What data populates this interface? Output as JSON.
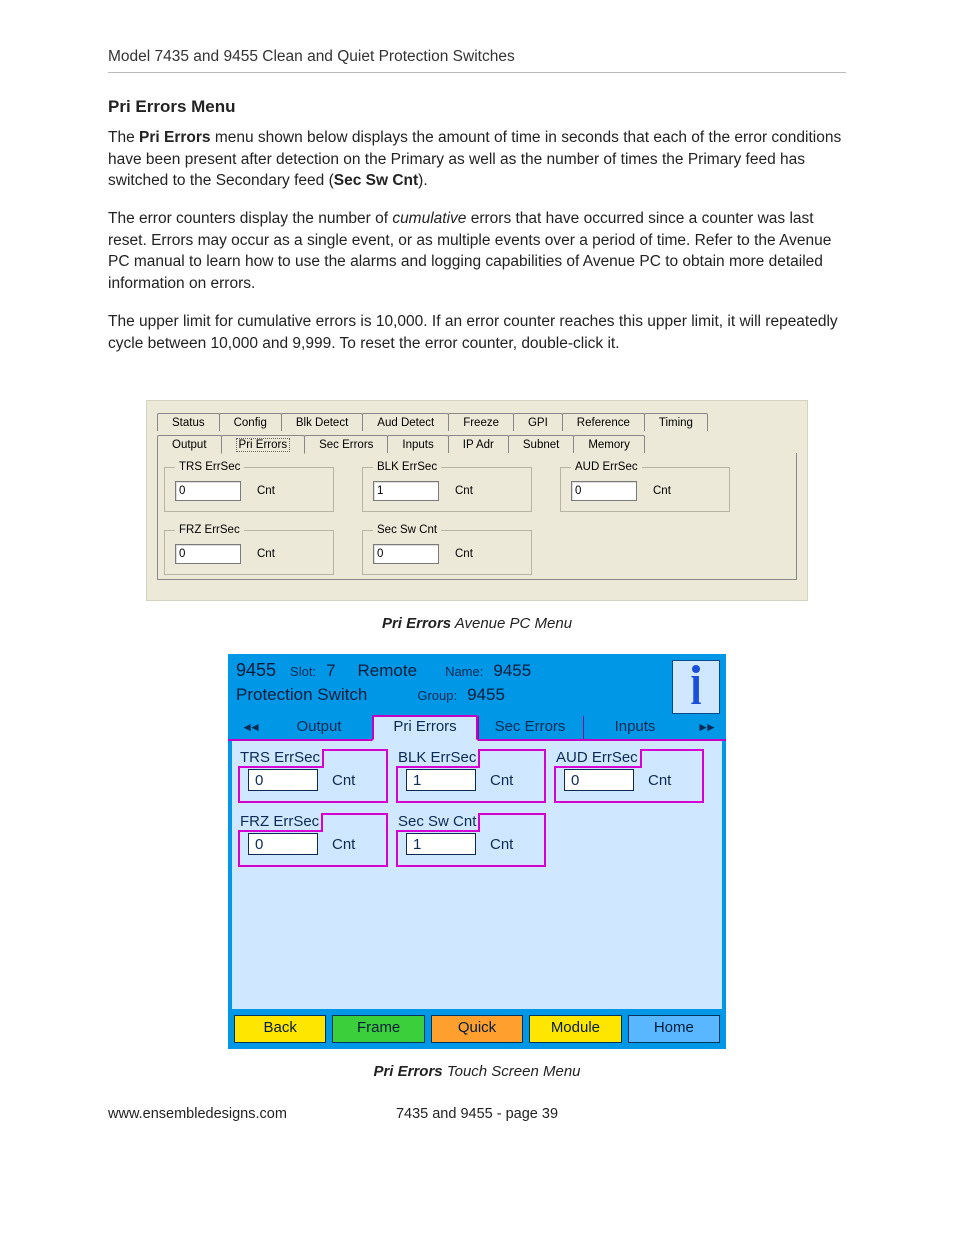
{
  "header": {
    "title": "Model 7435 and 9455 Clean and Quiet Protection Switches"
  },
  "section": {
    "heading": "Pri Errors Menu"
  },
  "paragraphs": {
    "p1_a": "The ",
    "p1_b": "Pri Errors",
    "p1_c": " menu shown below displays the amount of time in seconds that each of the error conditions have been present after detection on the Primary as well as the number of times the Primary feed has switched to the Secondary feed (",
    "p1_d": "Sec Sw Cnt",
    "p1_e": ").",
    "p2_a": "The error counters display the number of ",
    "p2_b": "cumulative",
    "p2_c": " errors that have occurred since a counter was last reset. Errors may occur as a single event, or as multiple events over a period of time. Refer to the Avenue PC manual to learn how to use the alarms and logging capabilities of Avenue PC to obtain more detailed information on errors.",
    "p3": "The upper limit for cumulative errors is 10,000. If an error counter reaches this upper limit, it will repeatedly cycle between 10,000 and 9,999. To reset the error counter, double-click it."
  },
  "pcmenu": {
    "tabs_row1": [
      "Status",
      "Config",
      "Blk Detect",
      "Aud Detect",
      "Freeze",
      "GPI",
      "Reference",
      "Timing"
    ],
    "tabs_row2": [
      "Output",
      "Pri Errors",
      "Sec Errors",
      "Inputs",
      "IP Adr",
      "Subnet",
      "Memory"
    ],
    "selected_tab": "Pri Errors",
    "groups": [
      {
        "legend": "TRS ErrSec",
        "value": "0",
        "unit": "Cnt"
      },
      {
        "legend": "BLK ErrSec",
        "value": "1",
        "unit": "Cnt"
      },
      {
        "legend": "AUD ErrSec",
        "value": "0",
        "unit": "Cnt"
      },
      {
        "legend": "FRZ ErrSec",
        "value": "0",
        "unit": "Cnt"
      },
      {
        "legend": "Sec Sw Cnt",
        "value": "0",
        "unit": "Cnt"
      }
    ]
  },
  "caption1": {
    "lead": "Pri Errors",
    "rest": " Avenue PC Menu"
  },
  "touch": {
    "model": "9455",
    "slot_label": "Slot:",
    "slot_value": "7",
    "mode": "Remote",
    "name_label": "Name:",
    "name_value": "9455",
    "subtitle": "Protection Switch",
    "group_label": "Group:",
    "group_value": "9455",
    "tabs": [
      "Output",
      "Pri Errors",
      "Sec Errors",
      "Inputs"
    ],
    "selected_tab": "Pri Errors",
    "groups": [
      {
        "legend": "TRS ErrSec",
        "value": "0",
        "unit": "Cnt"
      },
      {
        "legend": "BLK ErrSec",
        "value": "1",
        "unit": "Cnt"
      },
      {
        "legend": "AUD ErrSec",
        "value": "0",
        "unit": "Cnt"
      },
      {
        "legend": "FRZ ErrSec",
        "value": "0",
        "unit": "Cnt"
      },
      {
        "legend": "Sec Sw Cnt",
        "value": "1",
        "unit": "Cnt"
      }
    ],
    "footer": [
      "Back",
      "Frame",
      "Quick",
      "Module",
      "Home"
    ]
  },
  "caption2": {
    "lead": "Pri Errors",
    "rest": " Touch Screen Menu"
  },
  "footer": {
    "url": "www.ensembledesigns.com",
    "page": "7435 and 9455 - page 39"
  }
}
